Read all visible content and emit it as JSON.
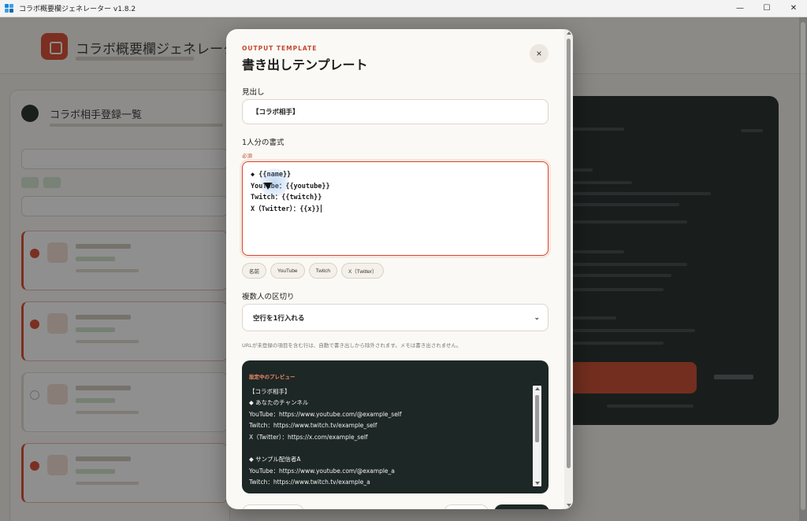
{
  "window": {
    "title": "コラボ概要欄ジェネレーター v1.8.2",
    "controls": {
      "minimize": "—",
      "maximize": "☐",
      "close": "✕"
    }
  },
  "background": {
    "app_title": "コラボ概要欄ジェネレーター",
    "panel_title": "コラボ相手登録一覧"
  },
  "modal": {
    "eyebrow": "OUTPUT TEMPLATE",
    "title": "書き出しテンプレート",
    "close_label": "×",
    "heading_label": "見出し",
    "heading_value": "【コラボ相手】",
    "format_label": "1人分の書式",
    "required_label": "必須",
    "template_lines": [
      "◆ {{name}}",
      "YouTube：{{youtube}}",
      "Twitch：{{twitch}}",
      "X（Twitter）：{{x}}"
    ],
    "chips": [
      "名前",
      "YouTube",
      "Twitch",
      "X（Twitter）"
    ],
    "separator_label": "複数人の区切り",
    "separator_value": "空行を1行入れる",
    "note": "URLが未登録の項目を含む行は、自動で書き出しから除外されます。メモは書き出されません。",
    "preview_label": "設定中のプレビュー",
    "preview_lines": [
      "【コラボ相手】",
      "◆ あなたのチャンネル",
      "YouTube：https://www.youtube.com/@example_self",
      "Twitch：https://www.twitch.tv/example_self",
      "X（Twitter）：https://x.com/example_self",
      "",
      "◆ サンプル配信者A",
      "YouTube：https://www.youtube.com/@example_a",
      "Twitch：https://www.twitch.tv/example_a"
    ]
  },
  "colors": {
    "accent": "#d9472b",
    "preview_bg": "#1d2725",
    "modal_bg": "#fbf9f5"
  }
}
